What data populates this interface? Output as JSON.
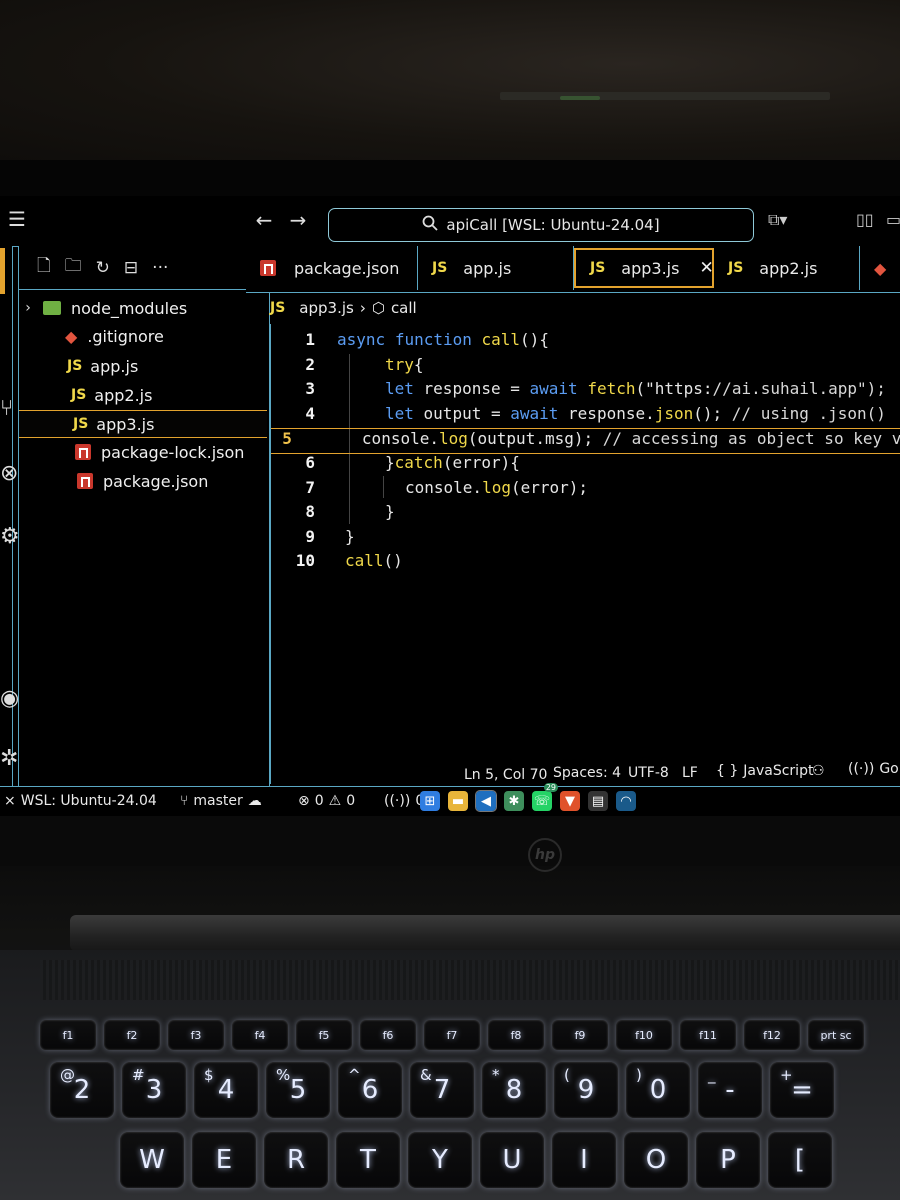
{
  "titlebar": {
    "search_text": "apiCall [WSL: Ubuntu-24.04]",
    "back_glyph": "←",
    "forward_glyph": "→"
  },
  "explorer": {
    "items": [
      {
        "label": "node_modules",
        "icon": "folder-icon",
        "type": "folder"
      },
      {
        "label": ".gitignore",
        "icon": "git-icon",
        "type": "file"
      },
      {
        "label": "app.js",
        "icon": "js-icon",
        "type": "file"
      },
      {
        "label": "app2.js",
        "icon": "js-icon",
        "type": "file"
      },
      {
        "label": "app3.js",
        "icon": "js-icon",
        "type": "file",
        "selected": true
      },
      {
        "label": "package-lock.json",
        "icon": "npm-icon",
        "type": "file"
      },
      {
        "label": "package.json",
        "icon": "npm-icon",
        "type": "file"
      }
    ]
  },
  "tabs": [
    {
      "label": "package.json",
      "icon": "npm-icon"
    },
    {
      "label": "app.js",
      "icon": "js-icon"
    },
    {
      "label": "app3.js",
      "icon": "js-icon",
      "active": true,
      "close": "✕"
    },
    {
      "label": "app2.js",
      "icon": "js-icon"
    }
  ],
  "breadcrumb": {
    "file": "app3.js",
    "symbol": "call"
  },
  "js_badge": "JS",
  "editor": {
    "current_line": 5,
    "lines": [
      {
        "n": "1",
        "text": "async function call(){"
      },
      {
        "n": "2",
        "text": "try{"
      },
      {
        "n": "3",
        "text": "let response = await fetch(\"https://ai.suhail.app\");"
      },
      {
        "n": "4",
        "text": "let output = await response.json(); // using .json()"
      },
      {
        "n": "5",
        "text": "console.log(output.msg); // accessing as object so key va"
      },
      {
        "n": "6",
        "text": "}catch(error){"
      },
      {
        "n": "7",
        "text": "console.log(error);"
      },
      {
        "n": "8",
        "text": "}"
      },
      {
        "n": "9",
        "text": "}"
      },
      {
        "n": "10",
        "text": "call()"
      }
    ]
  },
  "statusbar": {
    "remote": "WSL: Ubuntu-24.04",
    "branch": "master",
    "errors": "0",
    "warnings": "0",
    "ports": "0",
    "cursor": "Ln 5, Col 70",
    "spaces": "Spaces: 4",
    "encoding": "UTF-8",
    "eol": "LF",
    "language": "JavaScript",
    "golive": "Go Liv"
  },
  "taskbar": {
    "whatsapp_badge": "29"
  },
  "laptop": {
    "brand": "hp"
  },
  "keyboard": {
    "fn_row": [
      "f1",
      "f2",
      "f3",
      "f4",
      "f5",
      "f6",
      "f7",
      "f8",
      "f9",
      "f10",
      "f11",
      "f12",
      "prt sc"
    ],
    "number_row": [
      {
        "main": "2",
        "sym": "@"
      },
      {
        "main": "3",
        "sym": "#"
      },
      {
        "main": "4",
        "sym": "$"
      },
      {
        "main": "5",
        "sym": "%"
      },
      {
        "main": "6",
        "sym": "^"
      },
      {
        "main": "7",
        "sym": "&"
      },
      {
        "main": "8",
        "sym": "*"
      },
      {
        "main": "9",
        "sym": "("
      },
      {
        "main": "0",
        "sym": ")"
      },
      {
        "main": "-",
        "sym": "_"
      },
      {
        "main": "=",
        "sym": "+"
      }
    ],
    "letter_row": [
      "W",
      "E",
      "R",
      "T",
      "Y",
      "U",
      "I",
      "O",
      "P",
      "["
    ]
  }
}
